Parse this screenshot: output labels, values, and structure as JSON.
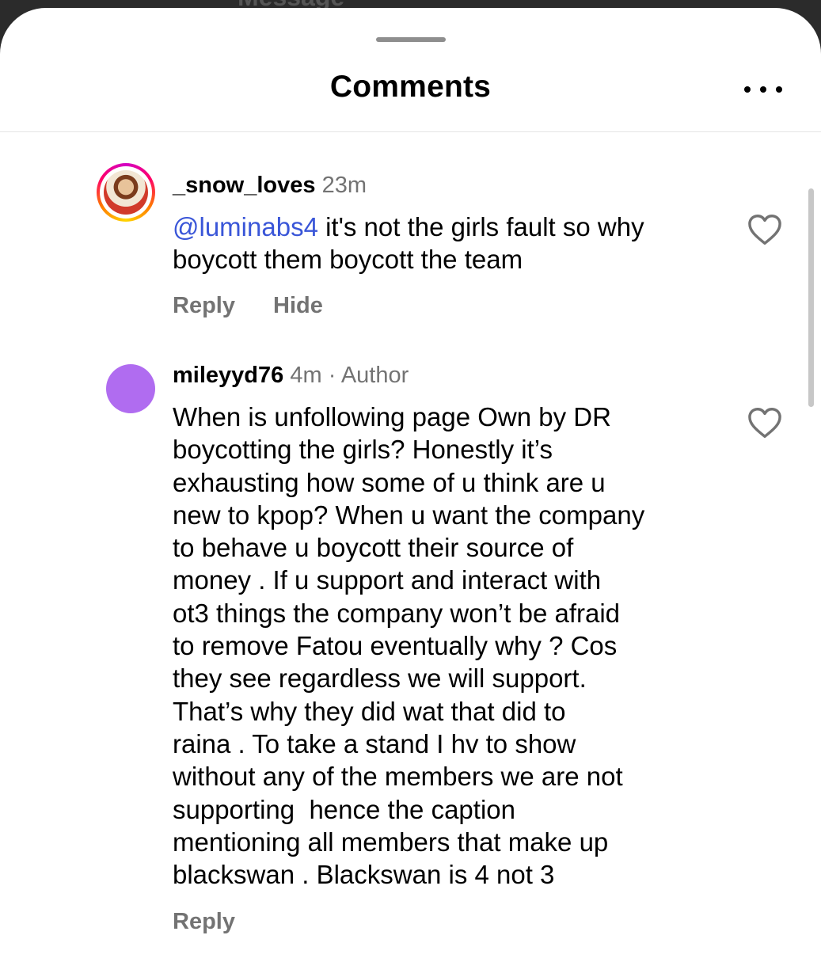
{
  "header": {
    "background_hint": "Message",
    "title": "Comments",
    "more_icon": "more-horizontal-icon"
  },
  "comments": [
    {
      "username": "_snow_loves",
      "time": "23m",
      "mention": "@luminabs4",
      "text": " it's not the girls fault so why boycott them boycott the team",
      "actions": [
        "Reply",
        "Hide"
      ],
      "like_icon": "heart-outline-icon",
      "avatar_story_ring": true
    },
    {
      "username": "mileyyd76",
      "time": "4m",
      "separator": "·",
      "badge": "Author",
      "text_lines": [
        "When is unfollowing page Own by DR",
        "boycotting the girls? Honestly it’s",
        "exhausting how some of u think are u",
        "new to kpop? When u want the company",
        "to behave u boycott their source of",
        "money . If u support and interact with",
        "ot3 things the company won’t be afraid",
        "to remove Fatou eventually why ? Cos",
        "they see regardless we will support.",
        "That’s why they did wat that did to",
        "raina . To take a stand I hv to show",
        "without any of the members we are not",
        "supporting  hence the caption",
        "mentioning all members that make up",
        "blackswan . Blackswan is 4 not 3"
      ],
      "actions": [
        "Reply"
      ],
      "like_icon": "heart-outline-icon",
      "avatar_color": "#b06cf0"
    }
  ],
  "colors": {
    "mention": "#3a56d8",
    "secondary_text": "#737373",
    "backdrop": "#2b2b2b"
  }
}
